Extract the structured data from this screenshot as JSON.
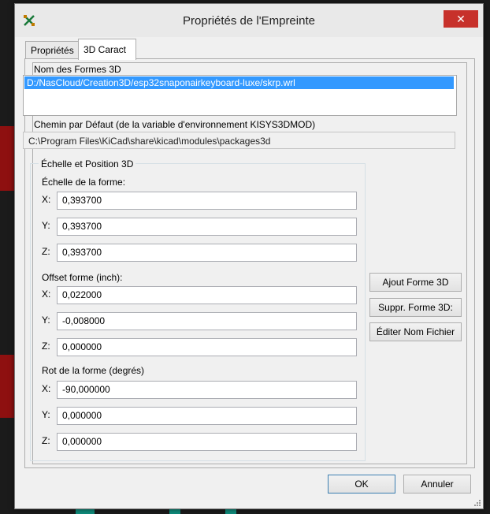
{
  "window": {
    "title": "Propriétés de l'Empreinte",
    "close_label": "✕"
  },
  "tabs": [
    {
      "label": "Propriétés",
      "active": false
    },
    {
      "label": "3D Caract",
      "active": true
    }
  ],
  "shapes": {
    "label": "Nom des Formes 3D",
    "items": [
      "D:/NasCloud/Creation3D/esp32snaponairkeyboard-luxe/skrp.wrl"
    ],
    "selected_index": 0
  },
  "default_path": {
    "label": "Chemin par Défaut (de la variable d'environnement KISYS3DMOD)",
    "value": "C:\\Program Files\\KiCad\\share\\kicad\\modules\\packages3d"
  },
  "scale_position": {
    "title": "Échelle et Position 3D",
    "scale": {
      "label": "Échelle de la forme:",
      "x": "0,393700",
      "y": "0,393700",
      "z": "0,393700"
    },
    "offset": {
      "label": "Offset forme  (inch):",
      "x": "0,022000",
      "y": "-0,008000",
      "z": "0,000000"
    },
    "rotation": {
      "label": "Rot de la forme (degrés)",
      "x": "-90,000000",
      "y": "0,000000",
      "z": "0,000000"
    },
    "axis": {
      "x": "X:",
      "y": "Y:",
      "z": "Z:"
    }
  },
  "side_buttons": {
    "add": "Ajout Forme 3D",
    "remove": "Suppr. Forme 3D:",
    "edit": "Éditer Nom Fichier"
  },
  "footer": {
    "ok": "OK",
    "cancel": "Annuler"
  },
  "colors": {
    "selection": "#3399ff",
    "close_button": "#c7312b",
    "background_red": "#8e1010",
    "background_teal": "#0f8a7a"
  }
}
